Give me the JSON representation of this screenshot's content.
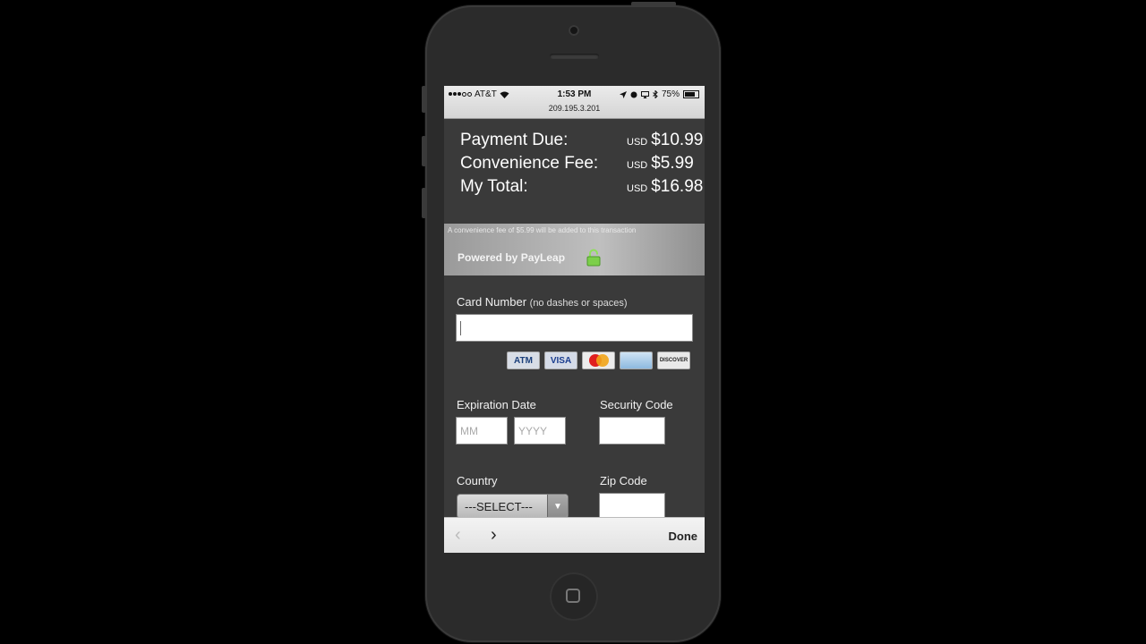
{
  "status_bar": {
    "carrier": "AT&T",
    "time": "1:53 PM",
    "battery_percent": "75%",
    "battery_level": 0.75,
    "url": "209.195.3.201"
  },
  "summary": {
    "payment_due_label": "Payment Due:",
    "payment_due_currency": "USD",
    "payment_due_value": "$10.99",
    "fee_label": "Convenience Fee:",
    "fee_currency": "USD",
    "fee_value": "$5.99",
    "total_label": "My Total:",
    "total_currency": "USD",
    "total_value": "$16.98"
  },
  "banner": {
    "note": "A convenience fee of $5.99 will be added to this transaction",
    "powered_by": "Powered by PayLeap"
  },
  "form": {
    "card_number_label": "Card Number",
    "card_number_hint": "(no dashes or spaces)",
    "card_number_value": "",
    "card_logos": [
      "ATM",
      "VISA",
      "MasterCard",
      "American Express",
      "DISCOVER"
    ],
    "atm_text": "ATM",
    "visa_text": "VISA",
    "discover_text": "DISCOVER",
    "expiration_label": "Expiration Date",
    "month_placeholder": "MM",
    "year_placeholder": "YYYY",
    "security_label": "Security Code",
    "country_label": "Country",
    "country_selected": "---SELECT---",
    "zip_label": "Zip Code"
  },
  "keyboard_bar": {
    "prev_symbol": "‹",
    "next_symbol": "›",
    "done_label": "Done"
  },
  "colors": {
    "screen_bg": "#3a3a3a",
    "lock_green": "#7ccf4a"
  }
}
